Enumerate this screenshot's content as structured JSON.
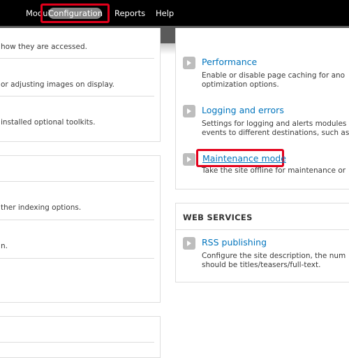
{
  "toolbar": {
    "modules": "Modules",
    "configuration": "Configuration",
    "reports": "Reports",
    "help": "Help"
  },
  "left": {
    "panel1": {
      "line1": "how they are accessed.",
      "line2": "or adjusting images on display.",
      "line3": "installed optional toolkits."
    },
    "panel2": {
      "line1": "ther indexing options.",
      "line2": "n."
    }
  },
  "right": {
    "panel1": {
      "items": [
        {
          "title": "Performance",
          "desc1": "Enable or disable page caching for ano",
          "desc2": "optimization options."
        },
        {
          "title": "Logging and errors",
          "desc1": "Settings for logging and alerts modules",
          "desc2": "events to different destinations, such as"
        },
        {
          "title": "Maintenance mode",
          "desc1": "Take the site offline for maintenance or"
        }
      ]
    },
    "panel2": {
      "heading": "WEB SERVICES",
      "items": [
        {
          "title": "RSS publishing",
          "desc1": "Configure the site description, the num",
          "desc2": "should be titles/teasers/full-text."
        }
      ]
    }
  }
}
